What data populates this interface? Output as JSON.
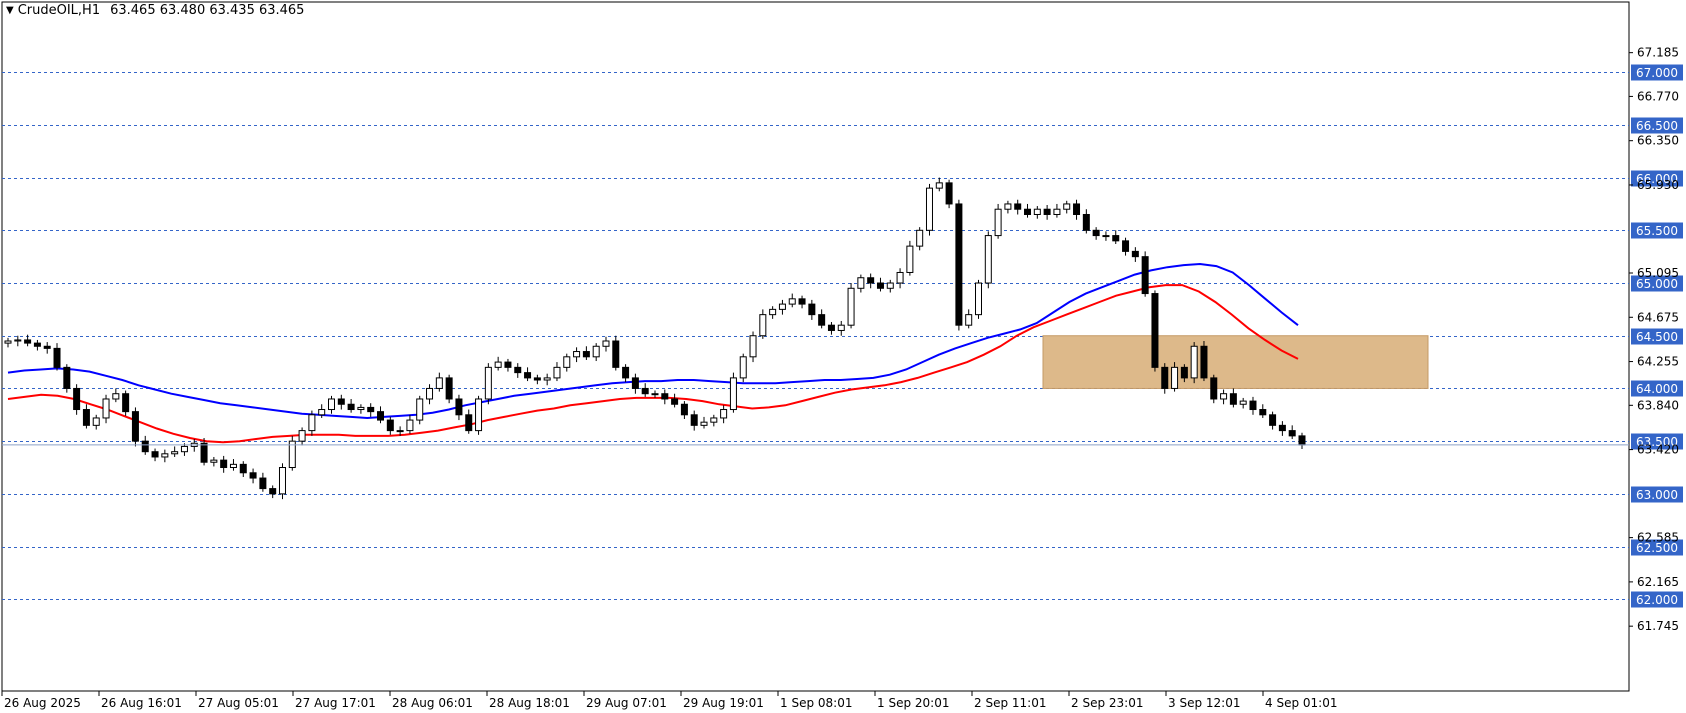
{
  "header": {
    "symbol": "CrudeOIL,H1",
    "ohlc": "63.465 63.480 63.435 63.465"
  },
  "colors": {
    "background": "#ffffff",
    "axis": "#000000",
    "grid_level": "#3465c8",
    "level_label_bg": "#3465c8",
    "level_label_text": "#ffffff",
    "ema_fast": "#0000ff",
    "ema_slow": "#ff0000",
    "zone_fill": "#ddb98a",
    "bull_candle_body": "#ffffff",
    "bear_candle_body": "#000000",
    "current_price_line": "#8ea2c8"
  },
  "chart_data": {
    "type": "candlestick",
    "timeframe": "H1",
    "y_axis": {
      "tick_labels": [
        "67.185",
        "66.770",
        "66.350",
        "65.930",
        "65.095",
        "64.675",
        "64.255",
        "63.840",
        "63.420",
        "62.585",
        "62.165",
        "61.745"
      ],
      "range": [
        61.5,
        67.4
      ]
    },
    "x_axis": {
      "tick_labels": [
        "26 Aug 2025",
        "26 Aug 16:01",
        "27 Aug 05:01",
        "27 Aug 17:01",
        "28 Aug 06:01",
        "28 Aug 18:01",
        "29 Aug 07:01",
        "29 Aug 19:01",
        "1 Sep 08:01",
        "1 Sep 20:01",
        "2 Sep 11:01",
        "2 Sep 23:01",
        "3 Sep 12:01",
        "4 Sep 01:01"
      ]
    },
    "horizontal_levels": [
      "67.000",
      "66.500",
      "66.000",
      "65.500",
      "65.000",
      "64.500",
      "64.000",
      "63.500",
      "63.000",
      "62.500",
      "62.000"
    ],
    "current_price": 63.465,
    "zone": {
      "top": 64.5,
      "bottom": 64.0
    },
    "closes": [
      64.45,
      64.46,
      64.43,
      64.4,
      64.38,
      64.2,
      64.0,
      63.8,
      63.65,
      63.72,
      63.9,
      63.95,
      63.78,
      63.5,
      63.4,
      63.35,
      63.38,
      63.4,
      63.45,
      63.48,
      63.3,
      63.32,
      63.25,
      63.28,
      63.2,
      63.15,
      63.05,
      63.0,
      63.25,
      63.5,
      63.6,
      63.75,
      63.8,
      63.9,
      63.85,
      63.8,
      63.82,
      63.78,
      63.7,
      63.6,
      63.6,
      63.7,
      63.9,
      64.0,
      64.1,
      63.9,
      63.75,
      63.6,
      63.9,
      64.2,
      64.25,
      64.2,
      64.15,
      64.1,
      64.08,
      64.1,
      64.2,
      64.3,
      64.35,
      64.3,
      64.4,
      64.45,
      64.2,
      64.1,
      64.0,
      63.95,
      63.95,
      63.9,
      63.85,
      63.75,
      63.65,
      63.68,
      63.72,
      63.8,
      64.1,
      64.3,
      64.5,
      64.7,
      64.75,
      64.8,
      64.85,
      64.8,
      64.7,
      64.6,
      64.55,
      64.6,
      64.95,
      65.05,
      65.0,
      64.95,
      65.0,
      65.1,
      65.35,
      65.5,
      65.9,
      65.95,
      65.75,
      64.6,
      64.7,
      65.0,
      65.45,
      65.7,
      65.75,
      65.7,
      65.65,
      65.7,
      65.65,
      65.7,
      65.75,
      65.65,
      65.5,
      65.45,
      65.45,
      65.4,
      65.3,
      65.25,
      64.9,
      64.2,
      64.0,
      64.2,
      64.1,
      64.4,
      64.1,
      63.9,
      63.95,
      63.85,
      63.88,
      63.8,
      63.75,
      63.65,
      63.6,
      63.55,
      63.465
    ],
    "ema_fast": [
      64.15,
      64.17,
      64.18,
      64.19,
      64.18,
      64.16,
      64.12,
      64.08,
      64.03,
      63.99,
      63.95,
      63.92,
      63.89,
      63.86,
      63.84,
      63.82,
      63.8,
      63.78,
      63.76,
      63.75,
      63.74,
      63.73,
      63.72,
      63.73,
      63.74,
      63.75,
      63.77,
      63.8,
      63.84,
      63.87,
      63.9,
      63.93,
      63.95,
      63.97,
      63.99,
      64.01,
      64.03,
      64.05,
      64.06,
      64.07,
      64.07,
      64.08,
      64.08,
      64.07,
      64.06,
      64.05,
      64.05,
      64.05,
      64.06,
      64.07,
      64.08,
      64.08,
      64.09,
      64.1,
      64.13,
      64.18,
      64.25,
      64.32,
      64.38,
      64.43,
      64.48,
      64.52,
      64.56,
      64.62,
      64.72,
      64.82,
      64.9,
      64.96,
      65.02,
      65.08,
      65.12,
      65.15,
      65.17,
      65.18,
      65.16,
      65.1,
      64.98,
      64.85,
      64.72,
      64.6
    ],
    "ema_slow": [
      63.9,
      63.92,
      63.94,
      63.93,
      63.9,
      63.85,
      63.8,
      63.74,
      63.68,
      63.62,
      63.57,
      63.53,
      63.5,
      63.49,
      63.5,
      63.52,
      63.54,
      63.55,
      63.56,
      63.56,
      63.56,
      63.55,
      63.55,
      63.55,
      63.56,
      63.58,
      63.6,
      63.63,
      63.66,
      63.7,
      63.73,
      63.76,
      63.79,
      63.81,
      63.84,
      63.86,
      63.88,
      63.9,
      63.91,
      63.91,
      63.91,
      63.9,
      63.88,
      63.85,
      63.83,
      63.81,
      63.82,
      63.84,
      63.88,
      63.92,
      63.96,
      63.99,
      64.01,
      64.03,
      64.06,
      64.1,
      64.15,
      64.2,
      64.25,
      64.32,
      64.4,
      64.5,
      64.58,
      64.64,
      64.7,
      64.76,
      64.82,
      64.88,
      64.92,
      64.96,
      64.98,
      64.98,
      64.92,
      64.82,
      64.7,
      64.57,
      64.46,
      64.36,
      64.28
    ]
  }
}
